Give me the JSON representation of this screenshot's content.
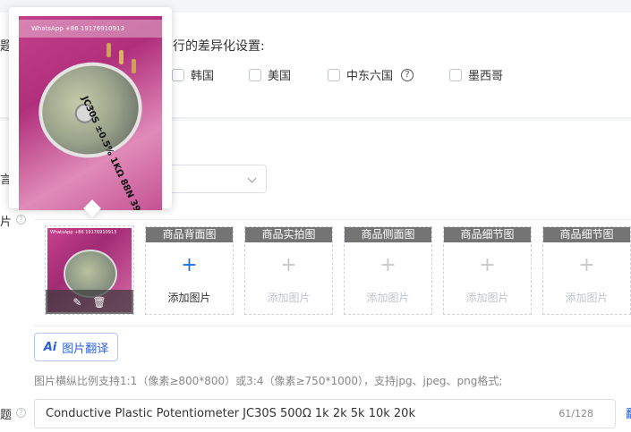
{
  "diff_settings": {
    "label_fragment": "题",
    "title_prefix": "...",
    "title_suffix": "行的差异化设置:",
    "countries": [
      {
        "label": "韩国",
        "checked": false
      },
      {
        "label": "美国",
        "checked": false
      },
      {
        "label": "中东六国",
        "checked": false,
        "help": "?"
      },
      {
        "label": "墨西哥",
        "checked": false
      }
    ]
  },
  "language": {
    "label_fragment": "言",
    "value": ""
  },
  "images": {
    "label_fragment": "片",
    "help": "?",
    "main_image": {
      "watermark": "WhatsApp +86 19176910913",
      "edit_icon": "pencil-icon",
      "delete_icon": "trash-icon"
    },
    "slots": [
      {
        "header": "商品背面图",
        "plus": "+",
        "add_label": "添加图片",
        "active": true
      },
      {
        "header": "商品实拍图",
        "plus": "+",
        "add_label": "添加图片",
        "active": false
      },
      {
        "header": "商品侧面图",
        "plus": "+",
        "add_label": "添加图片",
        "active": false
      },
      {
        "header": "商品细节图",
        "plus": "+",
        "add_label": "添加图片",
        "active": false
      },
      {
        "header": "商品细节图",
        "plus": "+",
        "add_label": "添加图片",
        "active": false
      }
    ],
    "translate_button": {
      "ai_badge": "Ai",
      "label": "图片翻译"
    },
    "hint": "图片横纵比例支持1:1（像素≥800*800）或3:4（像素≥750*1000），支持jpg、jpeg、png格式;"
  },
  "title_field": {
    "label_fragment": "题",
    "help": "?",
    "value": "Conductive Plastic Potentiometer JC30S 500Ω 1k 2k 5k 10k 20k",
    "counter": "61/128",
    "edge_link": "翻"
  },
  "preview_popover": {
    "watermark": "WhatsApp +86 19176910913",
    "product_text": "JC30S ±0.5% 1KΩ 88N 39"
  },
  "colors": {
    "accent": "#2b5fd9",
    "slot_header": "#747474",
    "page_bg": "#f4f5f7"
  }
}
